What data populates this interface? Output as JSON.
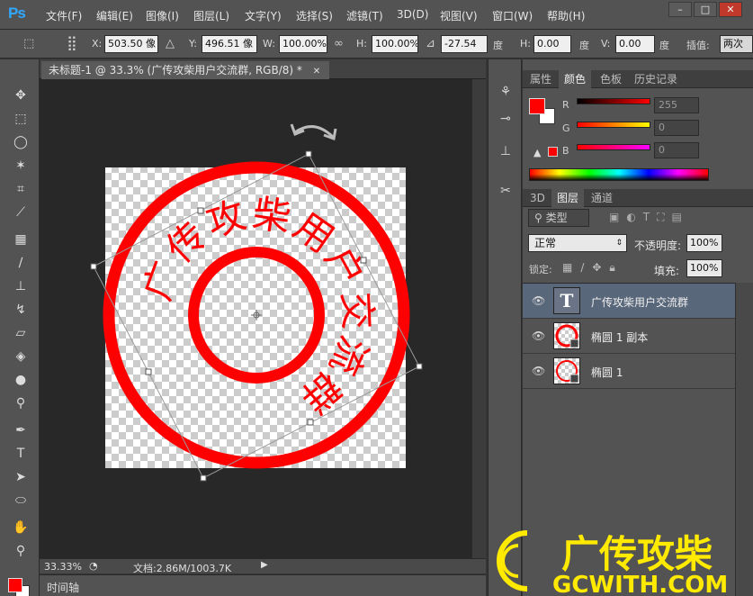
{
  "app": {
    "logo": "Ps"
  },
  "menu": [
    "文件(F)",
    "编辑(E)",
    "图像(I)",
    "图层(L)",
    "文字(Y)",
    "选择(S)",
    "滤镜(T)",
    "3D(D)",
    "视图(V)",
    "窗口(W)",
    "帮助(H)"
  ],
  "window_controls": {
    "minimize": "–",
    "maximize": "□",
    "close": "✕"
  },
  "options": {
    "x_label": "X:",
    "x_value": "503.50 像",
    "y_label": "Y:",
    "y_value": "496.51 像",
    "w_label": "W:",
    "w_value": "100.00%",
    "h_label": "H:",
    "h_value": "100.00%",
    "angle_value": "-27.54",
    "angle_unit": "度",
    "hskew_label": "H:",
    "hskew_value": "0.00",
    "hskew_unit": "度",
    "vskew_label": "V:",
    "vskew_value": "0.00",
    "vskew_unit": "度",
    "interp_label": "插值:",
    "interp_value": "两次"
  },
  "document": {
    "tab_title": "未标题-1 @ 33.3% (广传攻柴用户交流群, RGB/8) *",
    "tab_close": "✕",
    "stamp_text": [
      "广",
      "传",
      "攻",
      "柴",
      "用",
      "户",
      "交",
      "流",
      "群"
    ],
    "stamp_color": "#ff0000"
  },
  "status": {
    "zoom": "33.33%",
    "doc_info": "文档:2.86M/1003.7K"
  },
  "timeline": {
    "label": "时间轴"
  },
  "color_panel": {
    "tabs": [
      "属性",
      "颜色",
      "色板",
      "历史记录"
    ],
    "active_tab": "颜色",
    "r_label": "R",
    "r_value": "255",
    "g_label": "G",
    "g_value": "0",
    "b_label": "B",
    "b_value": "0",
    "foreground": "#ff0000",
    "background": "#ffffff"
  },
  "layers_panel": {
    "tabs": [
      "3D",
      "图层",
      "通道"
    ],
    "active_tab": "图层",
    "filter_label": "类型",
    "blend_mode": "正常",
    "opacity_label": "不透明度:",
    "opacity_value": "100%",
    "lock_label": "锁定:",
    "fill_label": "填充:",
    "fill_value": "100%",
    "layers": [
      {
        "name": "广传攻柴用户交流群",
        "type": "text",
        "selected": true
      },
      {
        "name": "椭圆 1 副本",
        "type": "shape",
        "selected": false
      },
      {
        "name": "椭圆 1",
        "type": "shape",
        "selected": false
      }
    ]
  },
  "watermark": {
    "brand": "广传攻柴",
    "site": "GCWITH.COM",
    "color": "#ffea00"
  }
}
